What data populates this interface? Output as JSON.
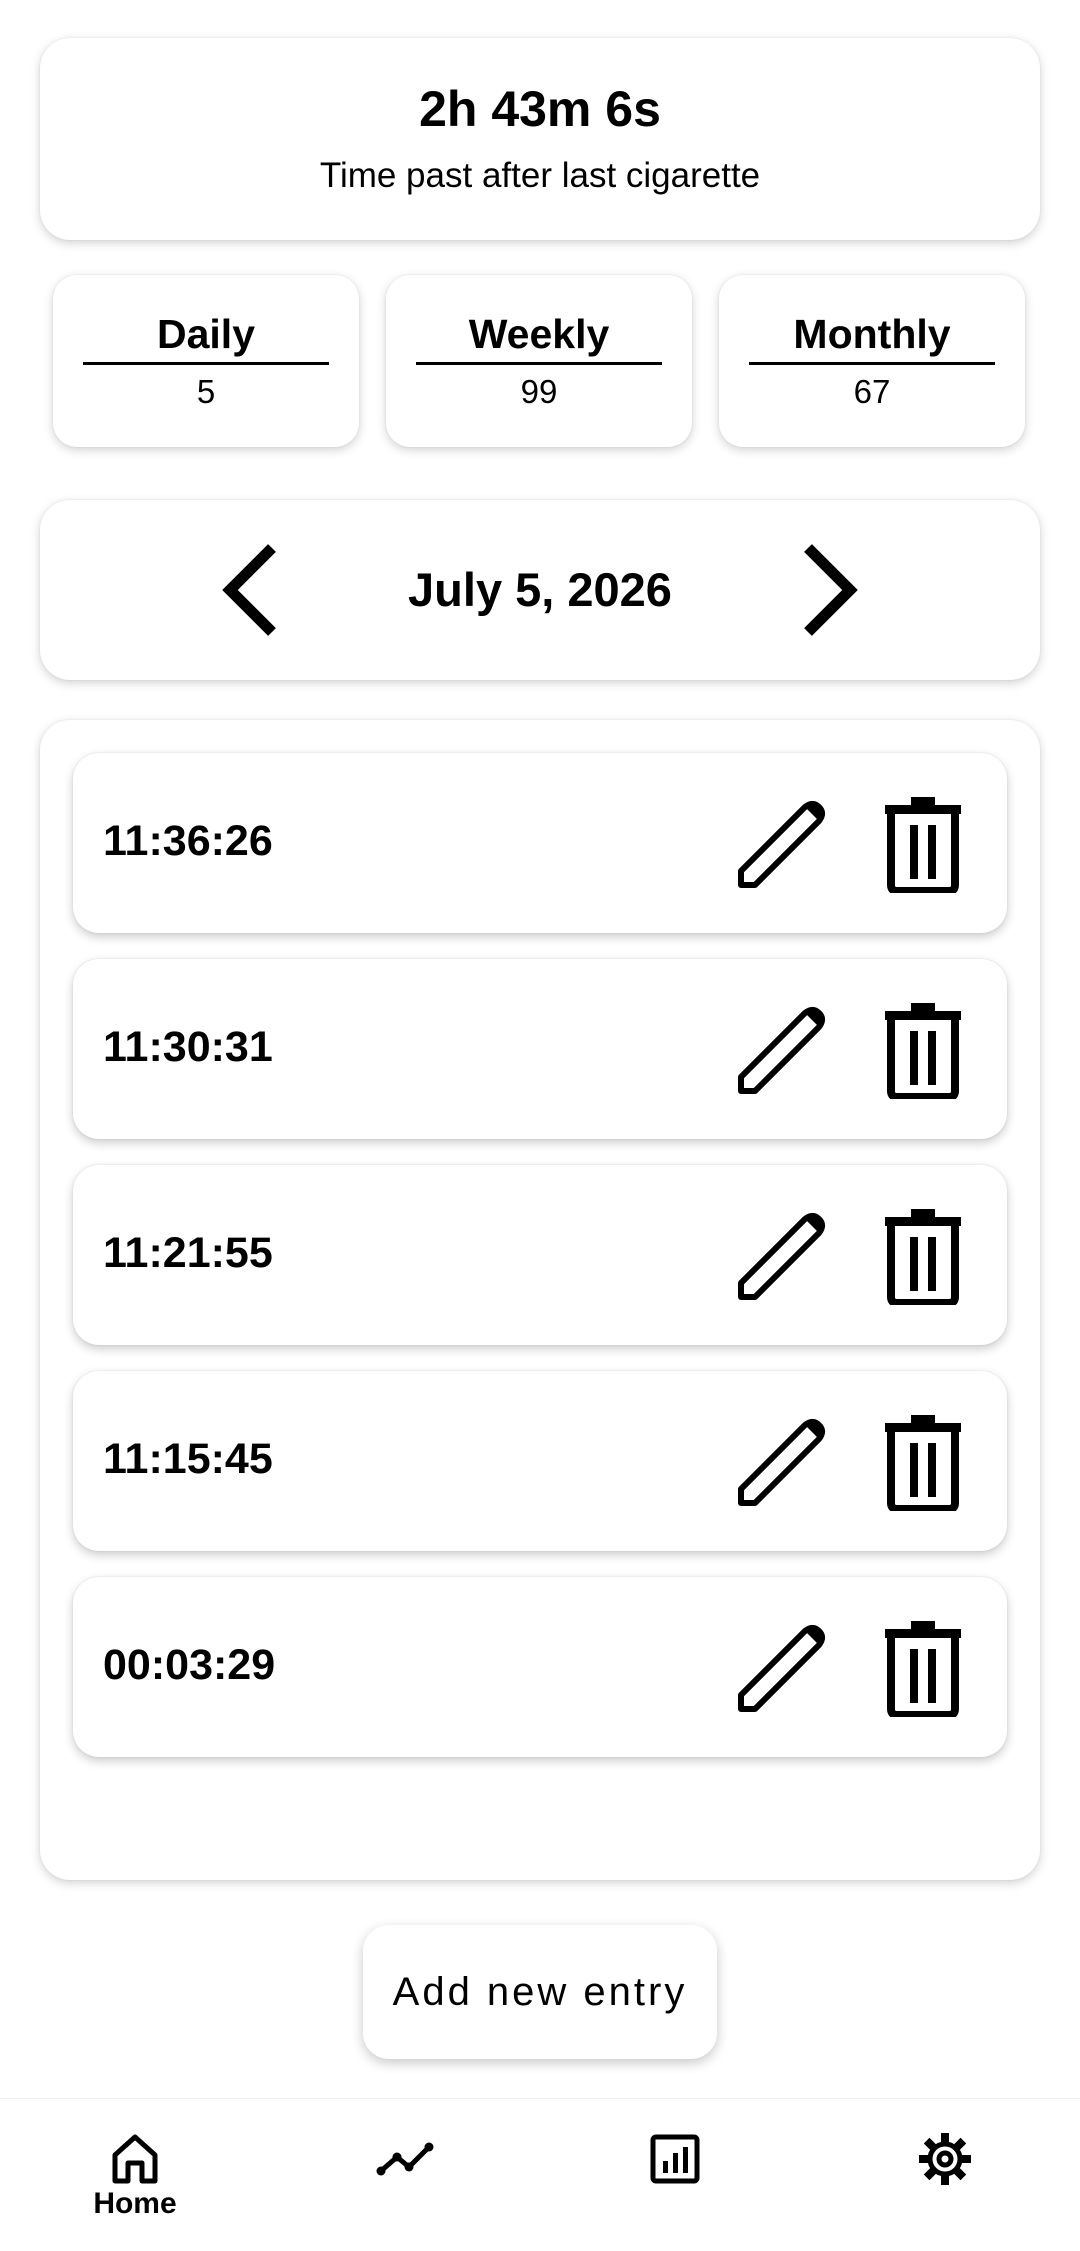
{
  "timer": {
    "value": "2h 43m 6s",
    "caption": "Time past after last cigarette"
  },
  "stats": {
    "daily": {
      "label": "Daily",
      "value": "5"
    },
    "weekly": {
      "label": "Weekly",
      "value": "99"
    },
    "monthly": {
      "label": "Monthly",
      "value": "67"
    }
  },
  "date_nav": {
    "date": "July 5, 2026",
    "prev_icon": "chevron-left-icon",
    "next_icon": "chevron-right-icon"
  },
  "entries": [
    {
      "time": "11:36:26"
    },
    {
      "time": "11:30:31"
    },
    {
      "time": "11:21:55"
    },
    {
      "time": "11:15:45"
    },
    {
      "time": "00:03:29"
    }
  ],
  "entry_icons": {
    "edit": "pencil-icon",
    "delete": "trash-icon"
  },
  "add_button": {
    "label": "Add new entry"
  },
  "bottom_nav": {
    "items": [
      {
        "label": "Home",
        "icon": "home-icon",
        "active": true
      },
      {
        "label": "",
        "icon": "trend-line-icon"
      },
      {
        "label": "",
        "icon": "bar-chart-icon"
      },
      {
        "label": "",
        "icon": "gear-icon"
      }
    ]
  }
}
